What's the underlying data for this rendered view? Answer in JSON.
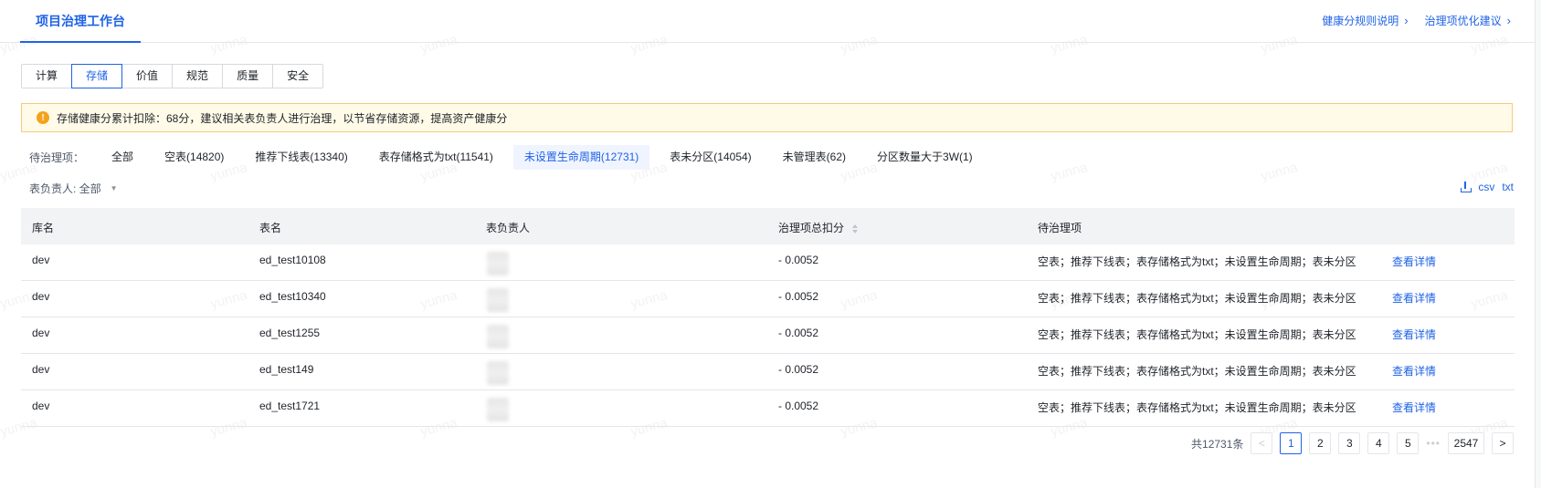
{
  "header": {
    "tab_title": "项目治理工作台",
    "links": [
      {
        "label": "健康分规则说明"
      },
      {
        "label": "治理项优化建议"
      }
    ]
  },
  "category_tabs": {
    "items": [
      "计算",
      "存储",
      "价值",
      "规范",
      "质量",
      "安全"
    ],
    "active": "存储"
  },
  "alert": {
    "text": "存储健康分累计扣除：68分，建议相关表负责人进行治理，以节省存储资源，提高资产健康分"
  },
  "filters": {
    "label": "待治理项：",
    "items": [
      "全部",
      "空表(14820)",
      "推荐下线表(13340)",
      "表存储格式为txt(11541)",
      "未设置生命周期(12731)",
      "表未分区(14054)",
      "未管理表(62)",
      "分区数量大于3W(1)"
    ],
    "active": "未设置生命周期(12731)"
  },
  "owner_filter": {
    "label": "表负责人: 全部"
  },
  "exports": {
    "csv": "csv",
    "txt": "txt"
  },
  "table": {
    "headers": {
      "db": "库名",
      "table": "表名",
      "owner": "表负责人",
      "score": "治理项总扣分",
      "items": "待治理项"
    },
    "rows": [
      {
        "db": "dev",
        "table": "ed_test10108",
        "score": "- 0.0052",
        "items": "空表；推荐下线表；表存储格式为txt；未设置生命周期；表未分区",
        "action": "查看详情"
      },
      {
        "db": "dev",
        "table": "ed_test10340",
        "score": "- 0.0052",
        "items": "空表；推荐下线表；表存储格式为txt；未设置生命周期；表未分区",
        "action": "查看详情"
      },
      {
        "db": "dev",
        "table": "ed_test1255",
        "score": "- 0.0052",
        "items": "空表；推荐下线表；表存储格式为txt；未设置生命周期；表未分区",
        "action": "查看详情"
      },
      {
        "db": "dev",
        "table": "ed_test149",
        "score": "- 0.0052",
        "items": "空表；推荐下线表；表存储格式为txt；未设置生命周期；表未分区",
        "action": "查看详情"
      },
      {
        "db": "dev",
        "table": "ed_test1721",
        "score": "- 0.0052",
        "items": "空表；推荐下线表；表存储格式为txt；未设置生命周期；表未分区",
        "action": "查看详情"
      }
    ]
  },
  "pagination": {
    "total": "共12731条",
    "pages": [
      "1",
      "2",
      "3",
      "4",
      "5"
    ],
    "ellipsis": "•••",
    "last": "2547",
    "current": "1",
    "prev": "<",
    "next": ">"
  },
  "watermark": "yunna"
}
